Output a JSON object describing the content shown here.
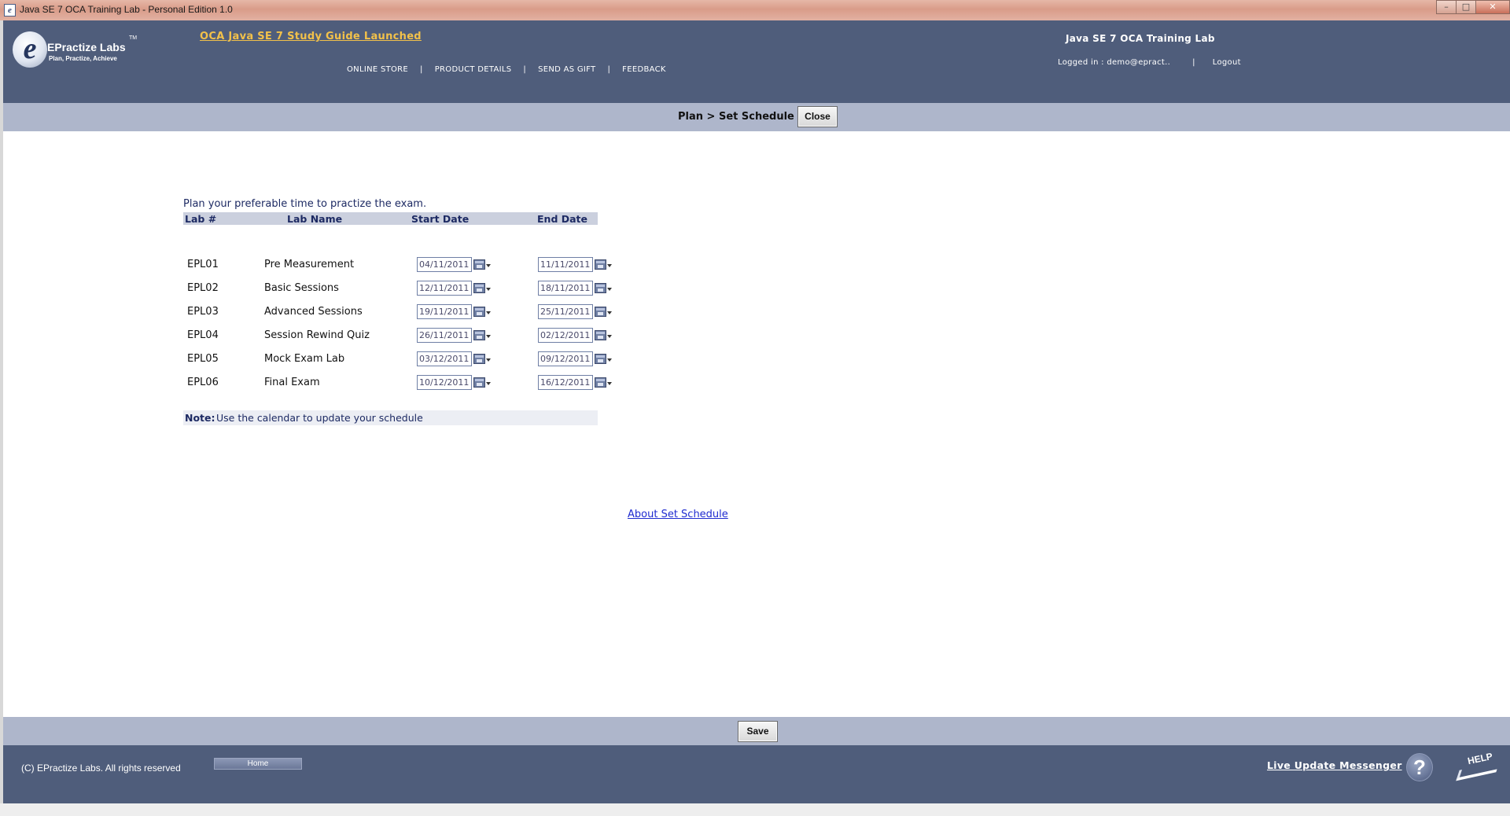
{
  "window": {
    "title": "Java SE 7 OCA Training Lab - Personal Edition 1.0",
    "controls": [
      "–",
      "□",
      "✕"
    ]
  },
  "header": {
    "logo": {
      "brand": "EPractize Labs",
      "tm": "TM",
      "tagline": "Plan, Practize, Achieve"
    },
    "announcement": "OCA Java SE 7 Study Guide Launched",
    "nav": [
      "ONLINE STORE",
      "PRODUCT DETAILS",
      "SEND AS GIFT",
      "FEEDBACK"
    ],
    "nav_separator": "|",
    "app_name": "Java SE 7 OCA Training Lab",
    "logged_in": "Logged in : demo@epract..",
    "logout": "Logout"
  },
  "breadcrumb": {
    "text": "Plan > Set Schedule",
    "close_label": "Close"
  },
  "schedule": {
    "intro": "Plan your preferable time to practize the exam.",
    "columns": [
      "Lab #",
      "Lab Name",
      "Start Date",
      "End Date"
    ],
    "rows": [
      {
        "id": "EPL01",
        "name": "Pre Measurement",
        "start": "04/11/2011",
        "end": "11/11/2011"
      },
      {
        "id": "EPL02",
        "name": "Basic Sessions",
        "start": "12/11/2011",
        "end": "18/11/2011"
      },
      {
        "id": "EPL03",
        "name": "Advanced Sessions",
        "start": "19/11/2011",
        "end": "25/11/2011"
      },
      {
        "id": "EPL04",
        "name": "Session Rewind Quiz",
        "start": "26/11/2011",
        "end": "02/12/2011"
      },
      {
        "id": "EPL05",
        "name": "Mock Exam Lab",
        "start": "03/12/2011",
        "end": "09/12/2011"
      },
      {
        "id": "EPL06",
        "name": "Final Exam",
        "start": "10/12/2011",
        "end": "16/12/2011"
      }
    ],
    "note_label": "Note:",
    "note_text": "Use the calendar to update your schedule",
    "about_link": "About Set Schedule"
  },
  "actions": {
    "save_label": "Save"
  },
  "footer": {
    "copyright": "(C) EPractize Labs. All rights reserved",
    "home_label": "Home",
    "messenger": "Live Update Messenger",
    "question_icon": "?",
    "help_text": "HELP"
  }
}
